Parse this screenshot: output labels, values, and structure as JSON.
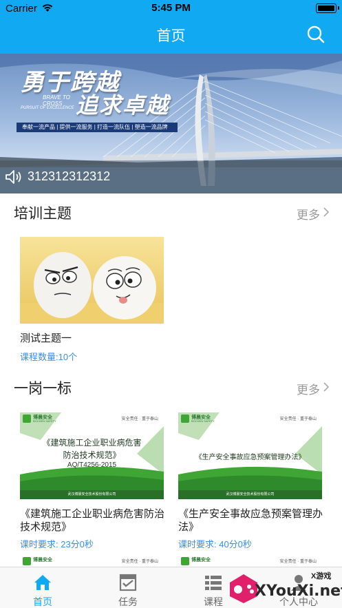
{
  "status_bar": {
    "carrier": "Carrier",
    "time": "5:45 PM"
  },
  "nav": {
    "title": "首页",
    "search_icon": "search-icon"
  },
  "banner": {
    "headline_1": "勇于跨越",
    "headline_2": "追求卓越",
    "english_1": "BRAVE TO\nCROSS",
    "english_2": "PURSUIT OF EXCELLENCE",
    "slogan": "奉献一流产品 | 提供一流服务 | 打造一流队伍 | 塑造一流品牌",
    "marquee_text": "312312312312"
  },
  "training": {
    "title": "培训主题",
    "more_label": "更多",
    "items": [
      {
        "title": "测试主题一",
        "sub": "课程数量:10个"
      }
    ]
  },
  "post": {
    "title": "一岗一标",
    "more_label": "更多",
    "items": [
      {
        "title": "《建筑施工企业职业病危害防治技术规范》",
        "sub": "课时要求: 23分0秒",
        "cover_brand": "博晨安全",
        "cover_brand_sub": "BOCHEN SAFETY",
        "cover_motto": "安全责任 · 重于泰山",
        "cover_line1": "《建筑施工企业职业病危害",
        "cover_line2": "防治技术规范》",
        "cover_code": "AQ/T4256-2015",
        "cover_footer": "武汉博晨安全技术股份有限公司"
      },
      {
        "title": "《生产安全事故应急预案管理办法》",
        "sub": "课时要求: 40分0秒",
        "cover_brand": "博晨安全",
        "cover_brand_sub": "BOCHEN SAFETY",
        "cover_motto": "安全责任 · 重于泰山",
        "cover_line1": "《生产安全事故应急预案管理办法》",
        "cover_footer": "武汉博晨安全技术股份有限公司"
      }
    ]
  },
  "tabbar": {
    "items": [
      {
        "label": "首页",
        "icon": "home-icon",
        "active": true
      },
      {
        "label": "任务",
        "icon": "task-icon",
        "active": false
      },
      {
        "label": "课程",
        "icon": "course-icon",
        "active": false
      },
      {
        "label": "个人中心",
        "icon": "profile-icon",
        "active": false
      }
    ]
  },
  "watermark": {
    "text": "XYouXi.net",
    "small": "X游戏"
  },
  "colors": {
    "primary": "#12a9f3",
    "link": "#3a8ee6",
    "cover_green": "#3fa535"
  }
}
